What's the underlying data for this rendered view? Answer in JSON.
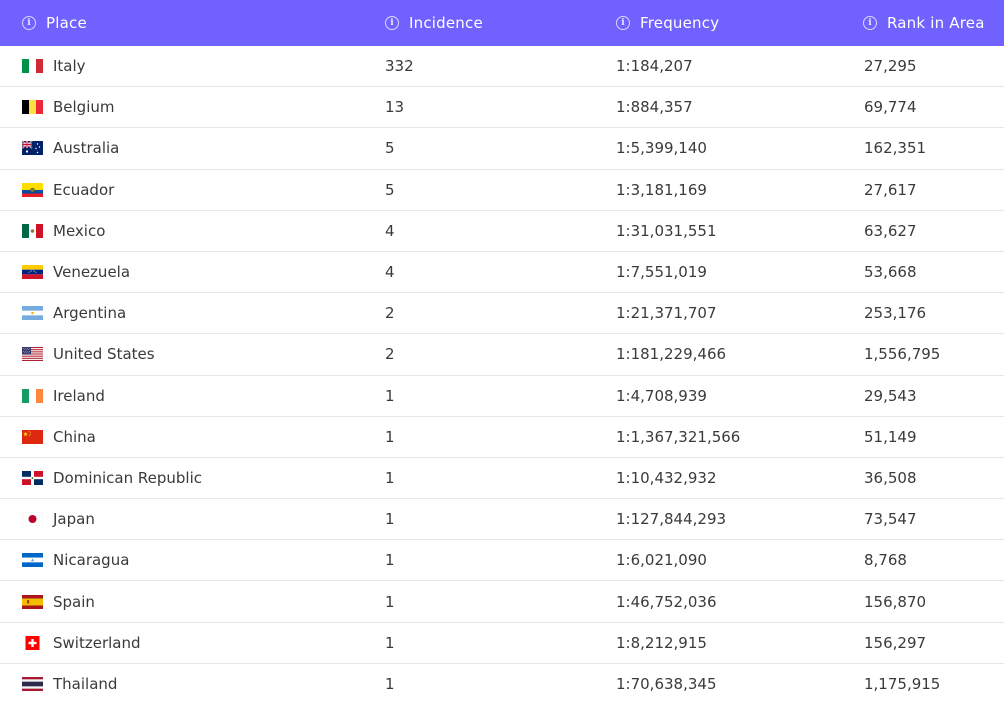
{
  "header": {
    "place": "Place",
    "incidence": "Incidence",
    "frequency": "Frequency",
    "rank": "Rank in Area"
  },
  "colors": {
    "header_bg": "#7161ff",
    "text": "#3a3a3a",
    "divider": "#e6e6e6"
  },
  "rows": [
    {
      "place": "Italy",
      "flag": "italy-flag-icon",
      "incidence": "332",
      "frequency": "1:184,207",
      "rank": "27,295"
    },
    {
      "place": "Belgium",
      "flag": "belgium-flag-icon",
      "incidence": "13",
      "frequency": "1:884,357",
      "rank": "69,774"
    },
    {
      "place": "Australia",
      "flag": "australia-flag-icon",
      "incidence": "5",
      "frequency": "1:5,399,140",
      "rank": "162,351"
    },
    {
      "place": "Ecuador",
      "flag": "ecuador-flag-icon",
      "incidence": "5",
      "frequency": "1:3,181,169",
      "rank": "27,617"
    },
    {
      "place": "Mexico",
      "flag": "mexico-flag-icon",
      "incidence": "4",
      "frequency": "1:31,031,551",
      "rank": "63,627"
    },
    {
      "place": "Venezuela",
      "flag": "venezuela-flag-icon",
      "incidence": "4",
      "frequency": "1:7,551,019",
      "rank": "53,668"
    },
    {
      "place": "Argentina",
      "flag": "argentina-flag-icon",
      "incidence": "2",
      "frequency": "1:21,371,707",
      "rank": "253,176"
    },
    {
      "place": "United States",
      "flag": "united-states-flag-icon",
      "incidence": "2",
      "frequency": "1:181,229,466",
      "rank": "1,556,795"
    },
    {
      "place": "Ireland",
      "flag": "ireland-flag-icon",
      "incidence": "1",
      "frequency": "1:4,708,939",
      "rank": "29,543"
    },
    {
      "place": "China",
      "flag": "china-flag-icon",
      "incidence": "1",
      "frequency": "1:1,367,321,566",
      "rank": "51,149"
    },
    {
      "place": "Dominican Republic",
      "flag": "dominican-republic-flag-icon",
      "incidence": "1",
      "frequency": "1:10,432,932",
      "rank": "36,508"
    },
    {
      "place": "Japan",
      "flag": "japan-flag-icon",
      "incidence": "1",
      "frequency": "1:127,844,293",
      "rank": "73,547"
    },
    {
      "place": "Nicaragua",
      "flag": "nicaragua-flag-icon",
      "incidence": "1",
      "frequency": "1:6,021,090",
      "rank": "8,768"
    },
    {
      "place": "Spain",
      "flag": "spain-flag-icon",
      "incidence": "1",
      "frequency": "1:46,752,036",
      "rank": "156,870"
    },
    {
      "place": "Switzerland",
      "flag": "switzerland-flag-icon",
      "incidence": "1",
      "frequency": "1:8,212,915",
      "rank": "156,297"
    },
    {
      "place": "Thailand",
      "flag": "thailand-flag-icon",
      "incidence": "1",
      "frequency": "1:70,638,345",
      "rank": "1,175,915"
    }
  ]
}
